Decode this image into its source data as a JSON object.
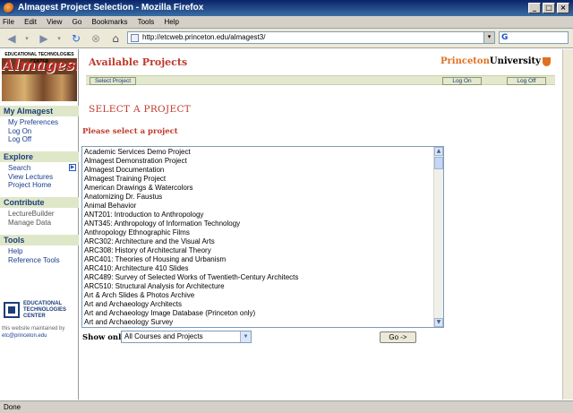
{
  "window": {
    "title": "Almagest Project Selection - Mozilla Firefox"
  },
  "menu": [
    "File",
    "Edit",
    "View",
    "Go",
    "Bookmarks",
    "Tools",
    "Help"
  ],
  "url": "http://etcweb.princeton.edu/almagest3/",
  "header": {
    "logo_org": "EDUCATIONAL TECHNOLOGIES CENTER",
    "logo_brand": "Almagest",
    "title": "Available Projects",
    "princeton_1": "Princeton",
    "princeton_2": "University"
  },
  "action_bar": {
    "select_project": "Select Project",
    "log_on": "Log On",
    "log_off": "Log Off"
  },
  "sidebar": {
    "my_almagest": {
      "heading": "My Almagest",
      "links": [
        "My Preferences",
        "Log On",
        "Log Off"
      ]
    },
    "explore": {
      "heading": "Explore",
      "links": [
        "Search",
        "View Lectures",
        "Project Home"
      ]
    },
    "contribute": {
      "heading": "Contribute",
      "links": [
        "LectureBuilder",
        "Manage Data"
      ]
    },
    "tools": {
      "heading": "Tools",
      "links": [
        "Help",
        "Reference Tools"
      ]
    },
    "etc_text": "EDUCATIONAL TECHNOLOGIES CENTER",
    "maintained_by": "this website maintained by",
    "maintainer_email": "etc@princeton.edu"
  },
  "main": {
    "section_title": "SELECT A PROJECT",
    "please": "Please select a project",
    "projects": [
      "Academic Services Demo Project",
      "Almagest Demonstration Project",
      "Almagest Documentation",
      "Almagest Training Project",
      "American Drawings & Watercolors",
      "Anatomizing Dr. Faustus",
      "Animal Behavior",
      "ANT201: Introduction to Anthropology",
      "ANT345: Anthropology of Information Technology",
      "Anthropology Ethnographic Films",
      "ARC302: Architecture and the Visual Arts",
      "ARC308: History of Architectural Theory",
      "ARC401: Theories of Housing and Urbanism",
      "ARC410: Architecture 410 Slides",
      "ARC489: Survey of Selected Works of Twentieth-Century Architects",
      "ARC510: Structural Analysis for Architecture",
      "Art & Arch Slides & Photos Archive",
      "Art and Archaeology Architects",
      "Art and Archaeology Image Database (Princeton only)",
      "Art and Archaeology Survey"
    ],
    "show_only_label": "Show only:",
    "show_only_value": "All Courses and Projects",
    "go_label": "Go ->"
  },
  "status": "Done"
}
